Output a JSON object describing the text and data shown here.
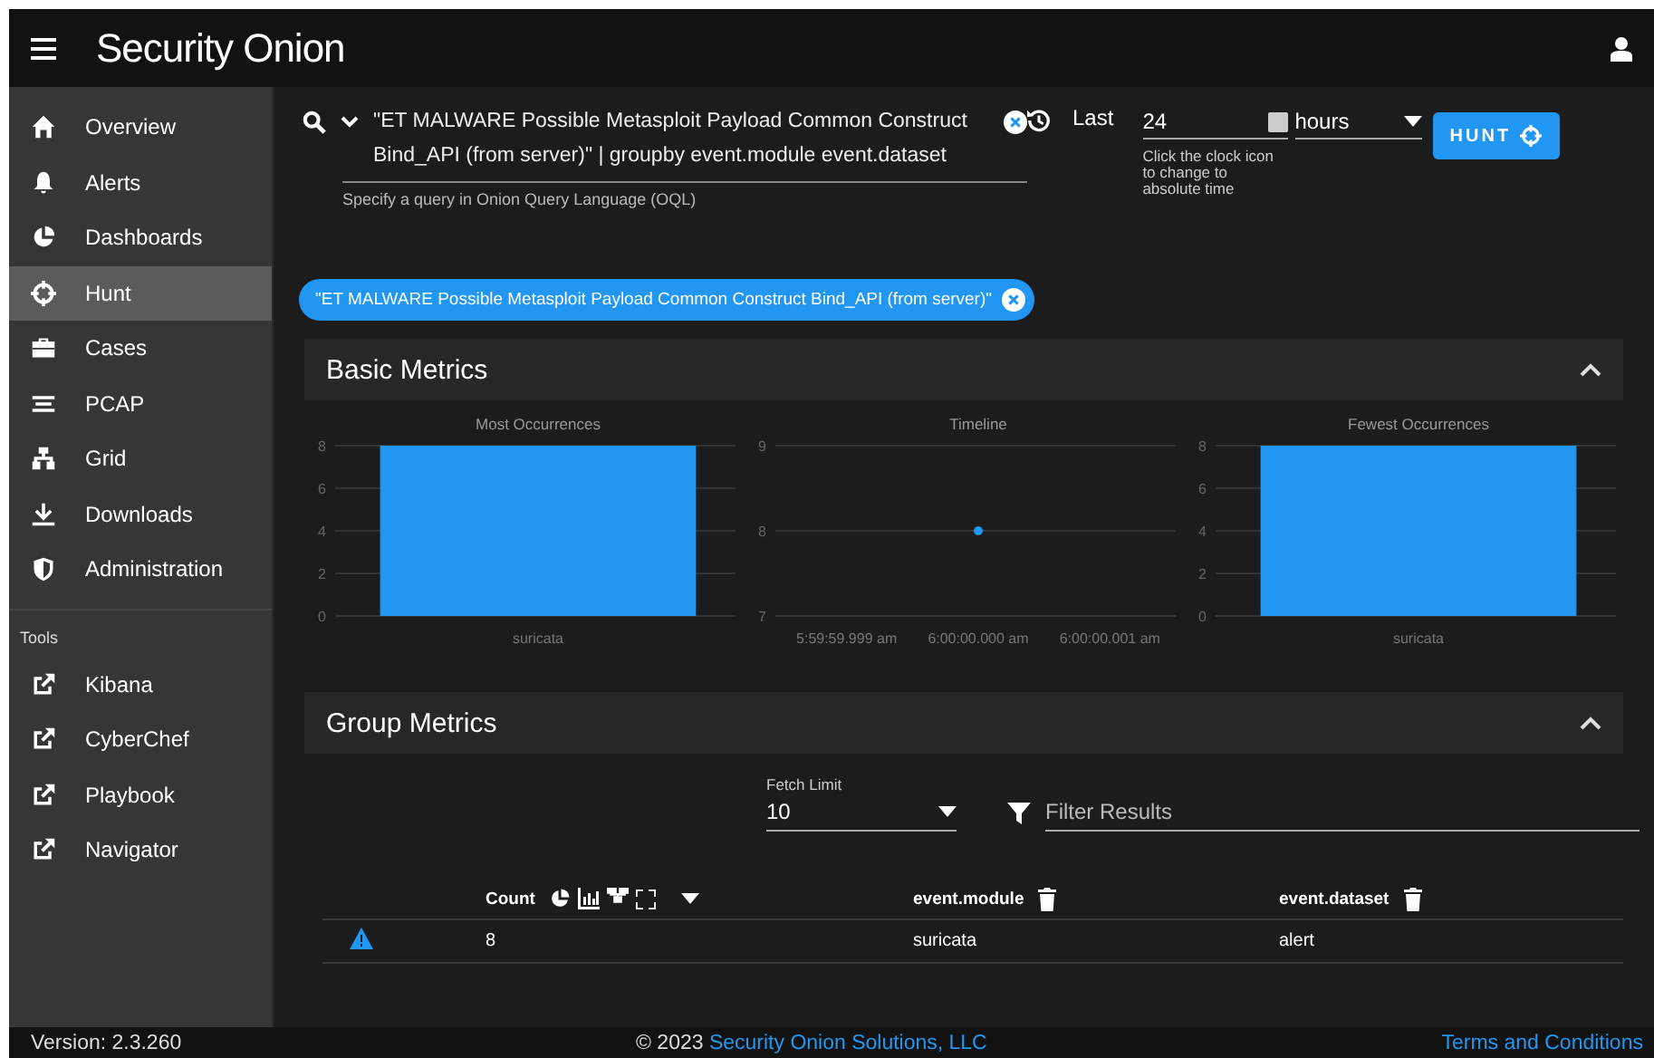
{
  "topbar": {
    "logo": "Security Onion"
  },
  "sidebar": {
    "items": [
      {
        "label": "Overview",
        "selected": false
      },
      {
        "label": "Alerts",
        "selected": false
      },
      {
        "label": "Dashboards",
        "selected": false
      },
      {
        "label": "Hunt",
        "selected": true
      },
      {
        "label": "Cases",
        "selected": false
      },
      {
        "label": "PCAP",
        "selected": false
      },
      {
        "label": "Grid",
        "selected": false
      },
      {
        "label": "Downloads",
        "selected": false
      },
      {
        "label": "Administration",
        "selected": false
      }
    ],
    "tools_label": "Tools",
    "tools": [
      {
        "label": "Kibana"
      },
      {
        "label": "CyberChef"
      },
      {
        "label": "Playbook"
      },
      {
        "label": "Navigator"
      }
    ]
  },
  "query": {
    "value": "\"ET MALWARE Possible Metasploit Payload Common Construct Bind_API (from server)\" | groupby event.module event.dataset",
    "hint": "Specify a query in Onion Query Language (OQL)"
  },
  "time": {
    "label": "Last",
    "value": "24",
    "hint": "Click the clock icon to change to absolute time",
    "unit": "hours"
  },
  "hunt_button": "HUNT",
  "chips": [
    {
      "label": "\"ET MALWARE Possible Metasploit Payload Common Construct Bind_API (from server)\""
    }
  ],
  "basic_metrics": {
    "title": "Basic Metrics",
    "expanded": true,
    "charts": [
      {
        "chart_data": {
          "type": "bar",
          "title": "Most Occurrences",
          "categories": [
            "suricata"
          ],
          "values": [
            8
          ],
          "ylim": [
            0,
            8
          ],
          "yticks": [
            0,
            2,
            4,
            6,
            8
          ],
          "grid": true
        }
      },
      {
        "chart_data": {
          "type": "line",
          "title": "Timeline",
          "categories": [
            "5:59:59.999 am",
            "6:00:00.000 am",
            "6:00:00.001 am"
          ],
          "values": [
            null,
            8,
            null
          ],
          "ylim": [
            7,
            9
          ],
          "yticks": [
            7,
            8,
            9
          ],
          "grid": true,
          "marker": true
        }
      },
      {
        "chart_data": {
          "type": "bar",
          "title": "Fewest Occurrences",
          "categories": [
            "suricata"
          ],
          "values": [
            8
          ],
          "ylim": [
            0,
            8
          ],
          "yticks": [
            0,
            2,
            4,
            6,
            8
          ],
          "grid": true
        }
      }
    ]
  },
  "group_metrics": {
    "title": "Group Metrics",
    "expanded": true,
    "fetch_limit": {
      "label": "Fetch Limit",
      "value": "10"
    },
    "filter": {
      "placeholder": "Filter Results"
    },
    "columns": [
      {
        "label": "Count"
      },
      {
        "label": "event.module"
      },
      {
        "label": "event.dataset"
      }
    ],
    "rows": [
      {
        "cells": [
          "8",
          "suricata",
          "alert"
        ]
      }
    ]
  },
  "footer": {
    "version": "Version: 2.3.260",
    "copyright": "© 2023 ",
    "company": "Security Onion Solutions, LLC",
    "terms": "Terms and Conditions"
  }
}
